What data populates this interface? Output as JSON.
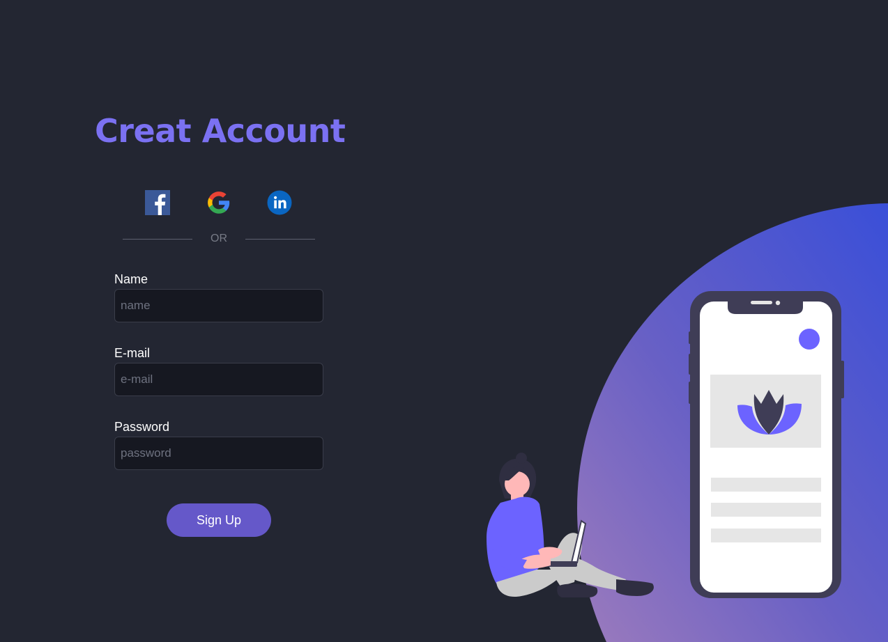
{
  "title": "Creat Account",
  "social": {
    "facebook": {
      "icon": "facebook-icon",
      "color": "#3b5998"
    },
    "google": {
      "icon": "google-icon"
    },
    "linkedin": {
      "icon": "linkedin-icon",
      "color": "#0a66c2"
    }
  },
  "divider_text": "OR",
  "form": {
    "name": {
      "label": "Name",
      "placeholder": "name"
    },
    "email": {
      "label": "E-mail",
      "placeholder": "e-mail"
    },
    "password": {
      "label": "Password",
      "placeholder": "password"
    }
  },
  "submit_label": "Sign Up",
  "colors": {
    "background": "#232632",
    "accent": "#7b71f2",
    "button": "#6558c9",
    "blob_gradient": [
      "#3a4fd8",
      "#9c7bbd"
    ]
  }
}
